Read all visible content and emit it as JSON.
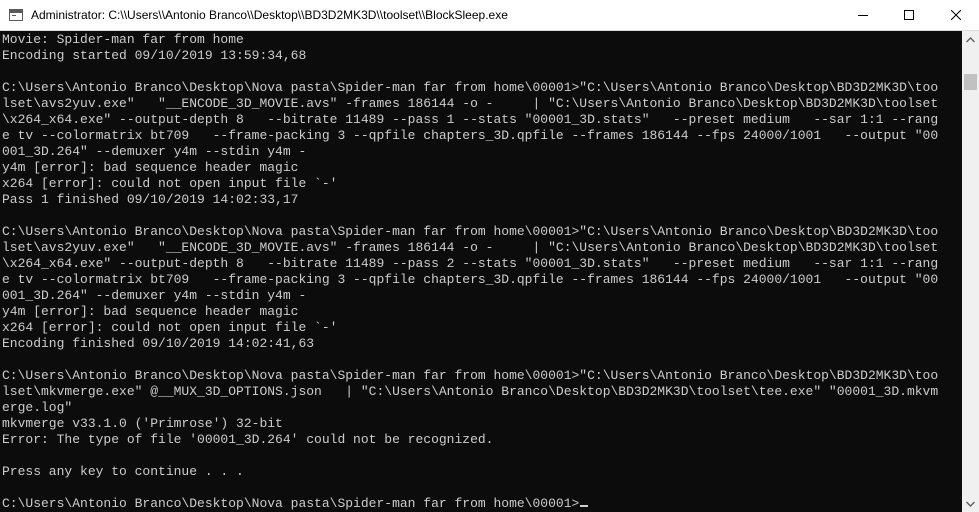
{
  "window": {
    "title": "Administrator: C:\\\\Users\\\\Antonio Branco\\\\Desktop\\\\BD3D2MK3D\\\\toolset\\\\BlockSleep.exe"
  },
  "console": {
    "lines": [
      "Movie: Spider-man far from home",
      "Encoding started 09/10/2019 13:59:34,68",
      "",
      "C:\\Users\\Antonio Branco\\Desktop\\Nova pasta\\Spider-man far from home\\00001>\"C:\\Users\\Antonio Branco\\Desktop\\BD3D2MK3D\\too",
      "lset\\avs2yuv.exe\"   \"__ENCODE_3D_MOVIE.avs\" -frames 186144 -o -     | \"C:\\Users\\Antonio Branco\\Desktop\\BD3D2MK3D\\toolset",
      "\\x264_x64.exe\" --output-depth 8   --bitrate 11489 --pass 1 --stats \"00001_3D.stats\"   --preset medium   --sar 1:1 --rang",
      "e tv --colormatrix bt709   --frame-packing 3 --qpfile chapters_3D.qpfile --frames 186144 --fps 24000/1001   --output \"00",
      "001_3D.264\" --demuxer y4m --stdin y4m -",
      "y4m [error]: bad sequence header magic",
      "x264 [error]: could not open input file `-'",
      "Pass 1 finished 09/10/2019 14:02:33,17",
      "",
      "C:\\Users\\Antonio Branco\\Desktop\\Nova pasta\\Spider-man far from home\\00001>\"C:\\Users\\Antonio Branco\\Desktop\\BD3D2MK3D\\too",
      "lset\\avs2yuv.exe\"   \"__ENCODE_3D_MOVIE.avs\" -frames 186144 -o -     | \"C:\\Users\\Antonio Branco\\Desktop\\BD3D2MK3D\\toolset",
      "\\x264_x64.exe\" --output-depth 8   --bitrate 11489 --pass 2 --stats \"00001_3D.stats\"   --preset medium   --sar 1:1 --rang",
      "e tv --colormatrix bt709   --frame-packing 3 --qpfile chapters_3D.qpfile --frames 186144 --fps 24000/1001   --output \"00",
      "001_3D.264\" --demuxer y4m --stdin y4m -",
      "y4m [error]: bad sequence header magic",
      "x264 [error]: could not open input file `-'",
      "Encoding finished 09/10/2019 14:02:41,63",
      "",
      "C:\\Users\\Antonio Branco\\Desktop\\Nova pasta\\Spider-man far from home\\00001>\"C:\\Users\\Antonio Branco\\Desktop\\BD3D2MK3D\\too",
      "lset\\mkvmerge.exe\" @__MUX_3D_OPTIONS.json   | \"C:\\Users\\Antonio Branco\\Desktop\\BD3D2MK3D\\toolset\\tee.exe\" \"00001_3D.mkvm",
      "erge.log\"",
      "mkvmerge v33.1.0 ('Primrose') 32-bit",
      "Error: The type of file '00001_3D.264' could not be recognized.",
      "",
      "Press any key to continue . . .",
      "",
      "C:\\Users\\Antonio Branco\\Desktop\\Nova pasta\\Spider-man far from home\\00001>"
    ]
  },
  "scrollbar": {
    "position": 0.06
  },
  "icons": {
    "app": "console-window-icon",
    "minimize": "minimize-icon",
    "maximize": "maximize-icon",
    "close": "close-icon",
    "scroll_up": "scroll-up-arrow-icon",
    "scroll_down": "scroll-down-arrow-icon"
  },
  "colors": {
    "background": "#0c0c0c",
    "text": "#cccccc",
    "titlebar": "#ffffff"
  }
}
